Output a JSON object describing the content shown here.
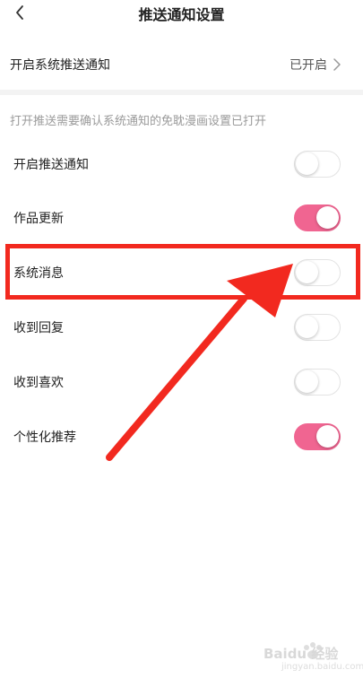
{
  "header": {
    "title": "推送通知设置"
  },
  "system_push": {
    "label": "开启系统推送通知",
    "status": "已开启"
  },
  "hint": "打开推送需要确认系统通知的免耽漫画设置已打开",
  "toggles": [
    {
      "label": "开启推送通知",
      "on": false
    },
    {
      "label": "作品更新",
      "on": true
    },
    {
      "label": "系统消息",
      "on": false
    },
    {
      "label": "收到回复",
      "on": false
    },
    {
      "label": "收到喜欢",
      "on": false
    },
    {
      "label": "个性化推荐",
      "on": true
    }
  ],
  "colors": {
    "toggle_on": "#f06591",
    "annotation": "#f2291f"
  },
  "watermark": {
    "text": "Baidu 经验",
    "sub": "jingyan.baidu.com"
  }
}
